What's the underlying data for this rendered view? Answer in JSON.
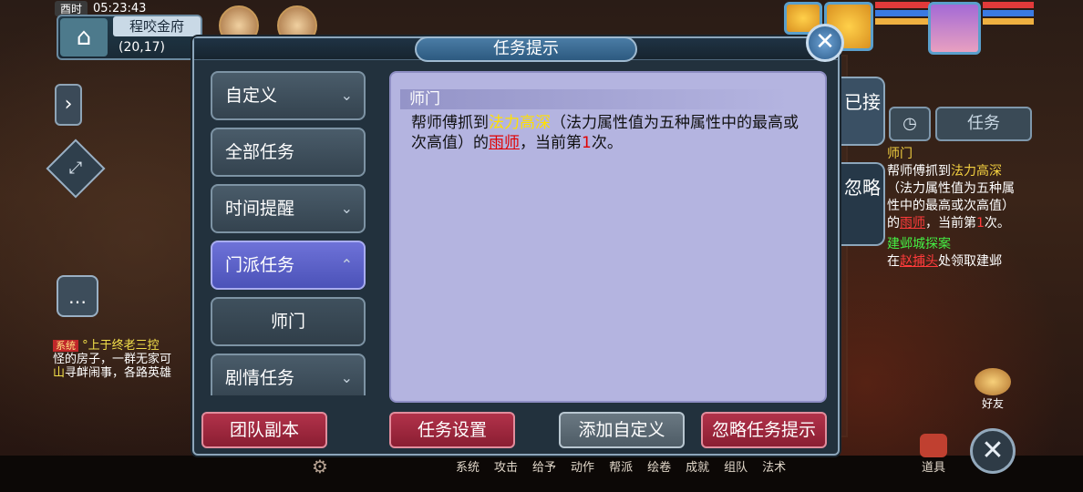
{
  "hud": {
    "day": "酉时",
    "time": "05:23:43",
    "location": "程咬金府",
    "coords": "(20,17)"
  },
  "chat": {
    "sys_tag": "系统",
    "line1": "°上于终老三控",
    "line2": "怪的房子，一群无家可",
    "line3a": "山",
    "line3b": "寻衅闹事，各路英雄"
  },
  "right_panel": {
    "tab_task": "任务",
    "track_title1": "师门",
    "track_text1a": "帮师傅抓到",
    "track_text1b": "法力高深",
    "track_text1c": "（法力属性值为五种属性中的最高或次高值）的",
    "track_text1d": "雨师",
    "track_text1e": "，当前第",
    "track_text1f": "1",
    "track_text1g": "次。",
    "track_title2": "建邺城探案",
    "track_text2a": "在",
    "track_text2b": "赵捕头",
    "track_text2c": "处领取建邺",
    "friend": "好友"
  },
  "bottom_menu": [
    "系统",
    "攻击",
    "给予",
    "动作",
    "帮派",
    "绘卷",
    "成就",
    "组队",
    "法术"
  ],
  "bag_label": "道具",
  "dialog": {
    "title": "任务提示",
    "categories": [
      {
        "label": "自定义",
        "chev": "⌄"
      },
      {
        "label": "全部任务",
        "chev": ""
      },
      {
        "label": "时间提醒",
        "chev": "⌄"
      },
      {
        "label": "门派任务",
        "chev": "⌃"
      },
      {
        "label": "师门",
        "chev": ""
      },
      {
        "label": "剧情任务",
        "chev": "⌄"
      }
    ],
    "detail_heading": "师门",
    "detail_a": "帮师傅抓到",
    "detail_b": "法力高深",
    "detail_c": "（法力属性值为五种属性中的最高或次高值）的",
    "detail_d": "雨师",
    "detail_e": "，当前第",
    "detail_f": "1",
    "detail_g": "次。",
    "tab_accepted": "已接",
    "tab_ignore": "忽略",
    "buttons": {
      "team_dungeon": "团队副本",
      "task_settings": "任务设置",
      "add_custom": "添加自定义",
      "ignore_tips": "忽略任务提示"
    }
  }
}
